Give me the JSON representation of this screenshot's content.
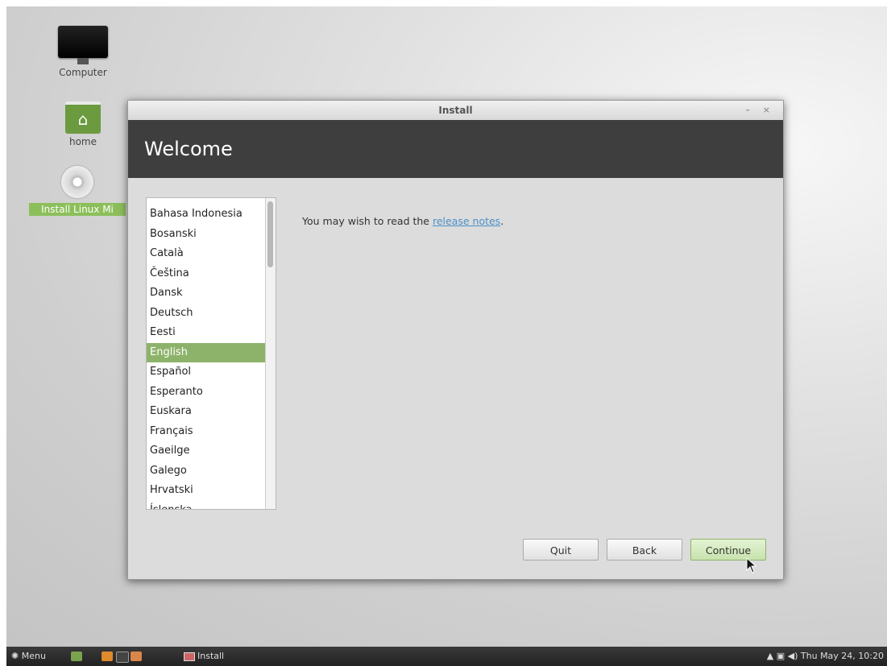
{
  "desktop": {
    "icons": [
      {
        "label": "Computer"
      },
      {
        "label": "home"
      },
      {
        "label": "Install Linux Mi"
      }
    ]
  },
  "window": {
    "title": "Install",
    "controls": "– ×",
    "header": "Welcome",
    "languages": [
      "Bahasa Indonesia",
      "Bosanski",
      "Català",
      "Čeština",
      "Dansk",
      "Deutsch",
      "Eesti",
      "English",
      "Español",
      "Esperanto",
      "Euskara",
      "Français",
      "Gaeilge",
      "Galego",
      "Hrvatski",
      "Íslenska"
    ],
    "selected_language": "English",
    "note_prefix": "You may wish to read the ",
    "note_link": "release notes",
    "note_suffix": ".",
    "buttons": {
      "quit": "Quit",
      "back": "Back",
      "continue": "Continue"
    }
  },
  "taskbar": {
    "menu": "Menu",
    "task": "Install",
    "clock": "Thu May 24, 10:20"
  }
}
